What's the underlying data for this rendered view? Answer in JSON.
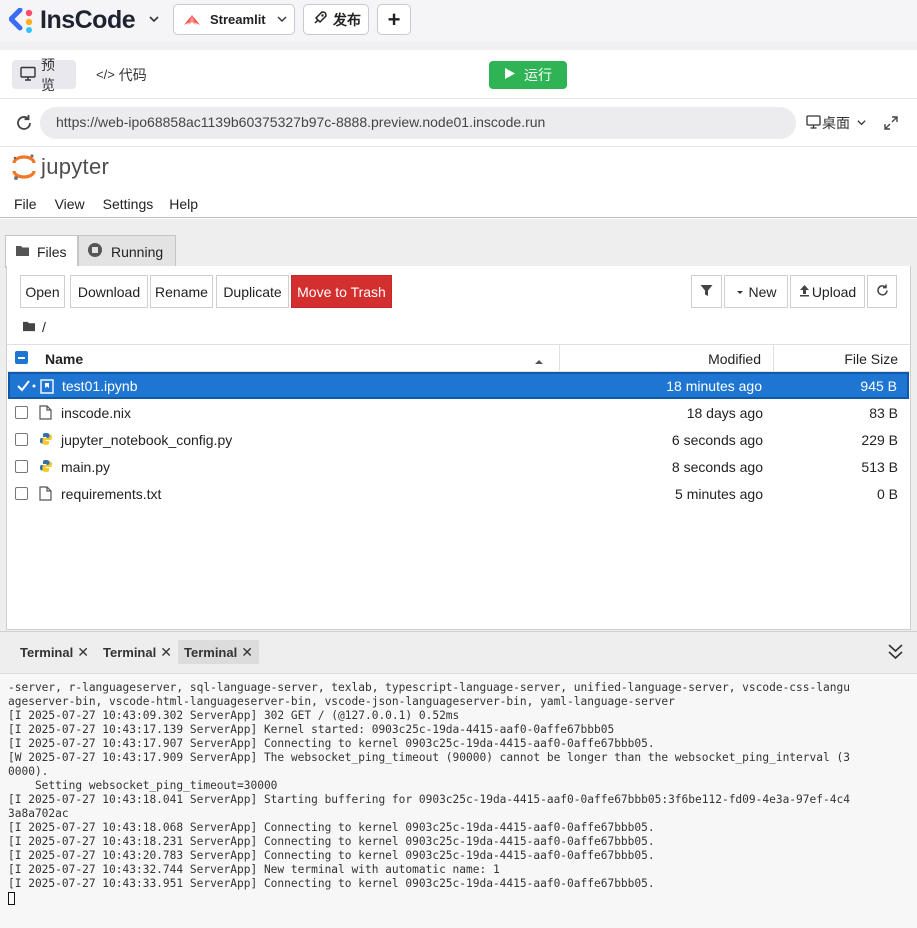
{
  "topbar": {
    "logo_text": "InsCode",
    "project_label": "Streamlit",
    "publish_label": "发布",
    "add_label": "+"
  },
  "mode_bar": {
    "preview_label": "预览",
    "code_label": "代码",
    "run_label": "运行"
  },
  "url_bar": {
    "url": "https://web-ipo68858ac1139b60375327b97c-8888.preview.node01.inscode.run",
    "device_label": "桌面"
  },
  "jupyter": {
    "logo_text": "jupyter",
    "menu": [
      "File",
      "View",
      "Settings",
      "Help"
    ],
    "tabs": [
      "Files",
      "Running"
    ],
    "toolbar": {
      "open": "Open",
      "download": "Download",
      "rename": "Rename",
      "duplicate": "Duplicate",
      "trash": "Move to Trash",
      "new": "New",
      "upload": "Upload"
    },
    "breadcrumb": "/",
    "columns": {
      "name": "Name",
      "modified": "Modified",
      "size": "File Size"
    },
    "files": [
      {
        "name": "test01.ipynb",
        "modified": "18 minutes ago",
        "size": "945 B",
        "icon": "notebook-icon",
        "selected": true
      },
      {
        "name": "inscode.nix",
        "modified": "18 days ago",
        "size": "83 B",
        "icon": "file-icon",
        "selected": false
      },
      {
        "name": "jupyter_notebook_config.py",
        "modified": "6 seconds ago",
        "size": "229 B",
        "icon": "python-icon",
        "selected": false
      },
      {
        "name": "main.py",
        "modified": "8 seconds ago",
        "size": "513 B",
        "icon": "python-icon",
        "selected": false
      },
      {
        "name": "requirements.txt",
        "modified": "5 minutes ago",
        "size": "0 B",
        "icon": "file-icon",
        "selected": false
      }
    ]
  },
  "terminal": {
    "tabs": [
      "Terminal",
      "Terminal",
      "Terminal"
    ],
    "active_tab": 2,
    "lines": [
      "-server, r-languageserver, sql-language-server, texlab, typescript-language-server, unified-language-server, vscode-css-langu",
      "ageserver-bin, vscode-html-languageserver-bin, vscode-json-languageserver-bin, yaml-language-server",
      "[I 2025-07-27 10:43:09.302 ServerApp] 302 GET / (@127.0.0.1) 0.52ms",
      "[I 2025-07-27 10:43:17.139 ServerApp] Kernel started: 0903c25c-19da-4415-aaf0-0affe67bbb05",
      "[I 2025-07-27 10:43:17.907 ServerApp] Connecting to kernel 0903c25c-19da-4415-aaf0-0affe67bbb05.",
      "[W 2025-07-27 10:43:17.909 ServerApp] The websocket_ping_timeout (90000) cannot be longer than the websocket_ping_interval (3",
      "0000).",
      "    Setting websocket_ping_timeout=30000",
      "[I 2025-07-27 10:43:18.041 ServerApp] Starting buffering for 0903c25c-19da-4415-aaf0-0affe67bbb05:3f6be112-fd09-4e3a-97ef-4c4",
      "3a8a702ac",
      "[I 2025-07-27 10:43:18.068 ServerApp] Connecting to kernel 0903c25c-19da-4415-aaf0-0affe67bbb05.",
      "[I 2025-07-27 10:43:18.231 ServerApp] Connecting to kernel 0903c25c-19da-4415-aaf0-0affe67bbb05.",
      "[I 2025-07-27 10:43:20.783 ServerApp] Connecting to kernel 0903c25c-19da-4415-aaf0-0affe67bbb05.",
      "[I 2025-07-27 10:43:32.744 ServerApp] New terminal with automatic name: 1",
      "[I 2025-07-27 10:43:33.951 ServerApp] Connecting to kernel 0903c25c-19da-4415-aaf0-0affe67bbb05."
    ]
  },
  "colors": {
    "run": "#2fb455",
    "trash": "#d32f2f",
    "selection": "#1f76d2",
    "jupyter_orange": "#f37726"
  }
}
